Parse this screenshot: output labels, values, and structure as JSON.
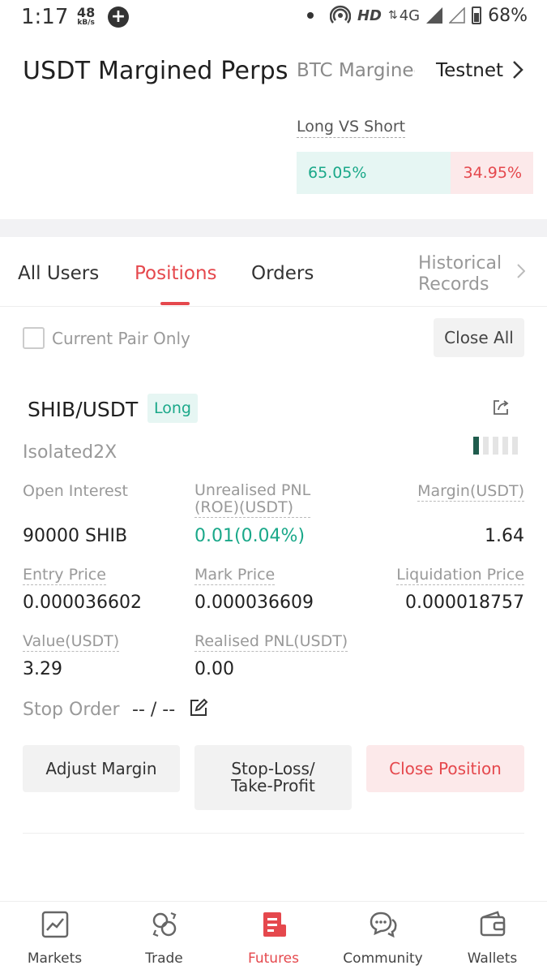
{
  "status_bar": {
    "time": "1:17",
    "speed_value": "48",
    "speed_unit": "kB/s",
    "network": "HD",
    "network_type": "4G",
    "battery": "68%"
  },
  "header": {
    "title": "USDT Margined Perps",
    "tabs": [
      "BTC Margined",
      "Testnet"
    ]
  },
  "long_short": {
    "label": "Long VS Short",
    "long_pct": "65.05%",
    "short_pct": "34.95%",
    "long_fraction": 0.6505
  },
  "tabs": {
    "all_users": "All Users",
    "positions": "Positions",
    "orders": "Orders",
    "historical": "Historical Records"
  },
  "filter": {
    "current_pair_only": "Current Pair Only",
    "checked": false,
    "close_all": "Close All"
  },
  "position": {
    "pair": "SHIB/USDT",
    "side": "Long",
    "mode": "Isolated2X",
    "strength_level": 1,
    "strength_max": 5,
    "open_interest_label": "Open Interest",
    "open_interest": "90000 SHIB",
    "pnl_label_1": "Unrealised PNL",
    "pnl_label_2": "(ROE)(USDT)",
    "pnl_value": "0.01(0.04%)",
    "margin_label": "Margin(USDT)",
    "margin": "1.64",
    "entry_price_label": "Entry Price",
    "entry_price": "0.000036602",
    "mark_price_label": "Mark Price",
    "mark_price": "0.000036609",
    "liq_price_label": "Liquidation Price",
    "liq_price": "0.000018757",
    "value_label": "Value(USDT)",
    "value": "3.29",
    "realised_label": "Realised PNL(USDT)",
    "realised": "0.00",
    "stop_order_label": "Stop Order",
    "stop_order_value": "-- / --"
  },
  "actions": {
    "adjust_margin": "Adjust Margin",
    "stop_loss_1": "Stop-Loss/",
    "stop_loss_2": "Take-Profit",
    "close_position": "Close Position"
  },
  "nav": {
    "markets": "Markets",
    "trade": "Trade",
    "futures": "Futures",
    "community": "Community",
    "wallets": "Wallets",
    "active": "futures"
  },
  "colors": {
    "accent_red": "#e5484d",
    "accent_green": "#1aa889"
  }
}
